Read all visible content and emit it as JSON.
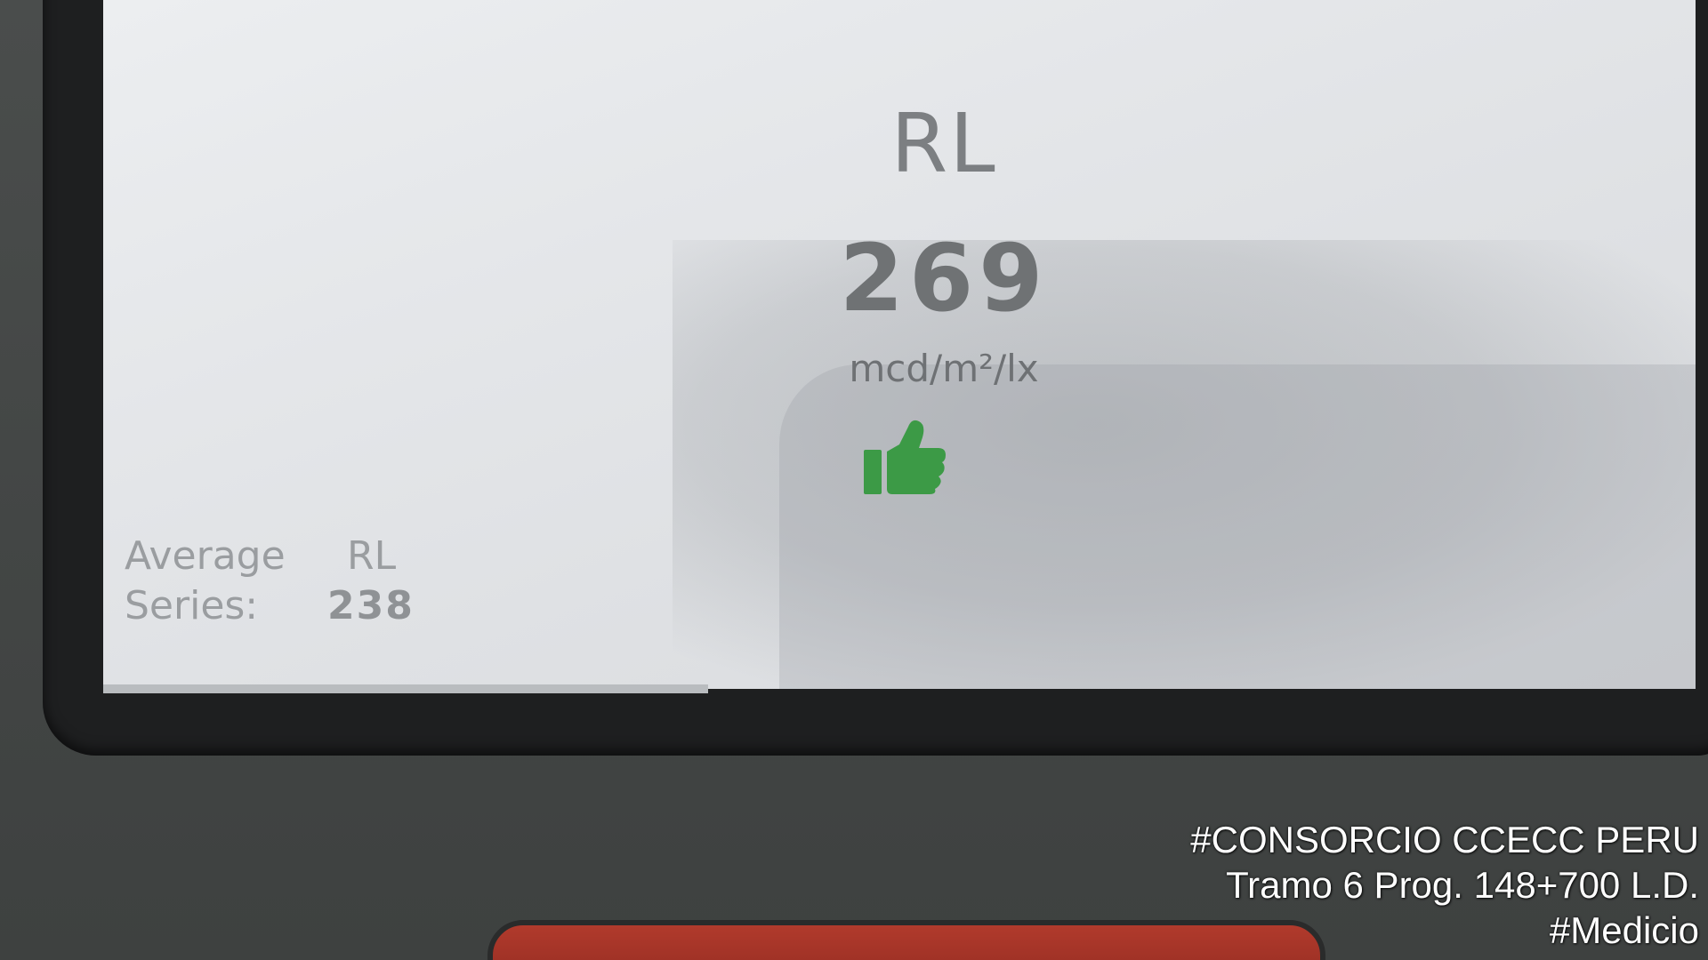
{
  "display": {
    "metric_label": "RL",
    "value": "269",
    "unit": "mcd/m²/lx",
    "status_icon": "thumbs-up-icon",
    "status_color": "#3c9a46"
  },
  "average": {
    "label_line1": "Average",
    "label_line2": "Series:",
    "metric_label": "RL",
    "value": "238"
  },
  "watermark": {
    "line1": "#CONSORCIO CCECC PERU",
    "line2": "Tramo 6 Prog. 148+700 L.D.",
    "line3": "#Medicio"
  }
}
